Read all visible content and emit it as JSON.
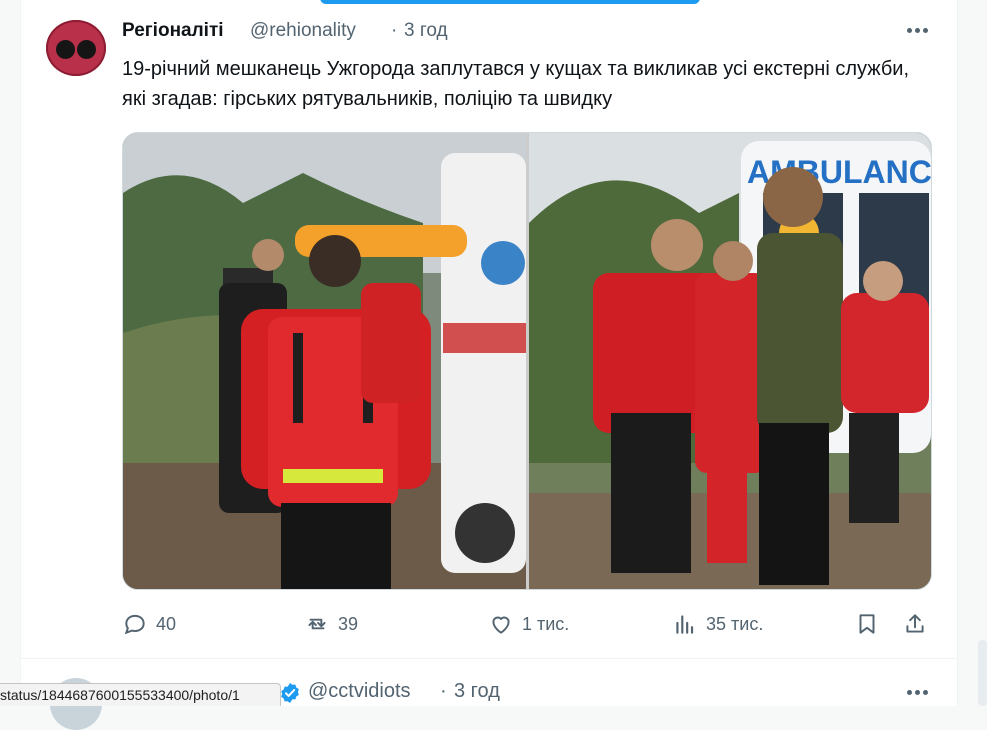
{
  "post": {
    "author_name": "Регіоналіті",
    "handle": "@rehionality",
    "separator": "·",
    "time": "3 год",
    "text": "19-річний мешканець Ужгорода заплутався у кущах та викликав усі екстерні служби, які згадав: гірських рятувальників, поліцію та швидку",
    "images": [
      {
        "icon": "photo-rescue-team"
      },
      {
        "icon": "photo-ambulance-crew",
        "text_on_vehicle": "AMBULANCE"
      }
    ],
    "actions": {
      "replies": "40",
      "reposts": "39",
      "likes": "1 тис.",
      "views": "35 тис."
    }
  },
  "next_post": {
    "handle": "@cctvidiots",
    "separator": "·",
    "time": "3 год"
  },
  "status_bar": {
    "url": "status/1844687600155533400/photo/1"
  },
  "colors": {
    "accent": "#1d9bf0",
    "text_secondary": "#536471",
    "avatar": "#b8304a"
  }
}
